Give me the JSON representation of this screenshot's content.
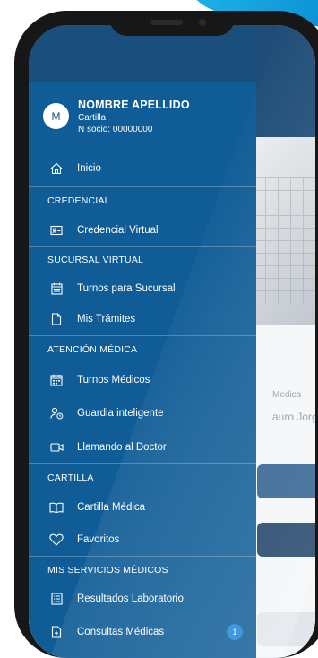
{
  "profile": {
    "initial": "M",
    "name": "NOMBRE APELLIDO",
    "plan": "Cartilla",
    "member_number": "N socio: 00000000"
  },
  "menu": {
    "inicio": "Inicio",
    "sec_credencial": "CREDENCIAL",
    "credencial_virtual": "Credencial Virtual",
    "sec_sucursal": "SUCURSAL VIRTUAL",
    "turnos_sucursal": "Turnos para Sucursal",
    "mis_tramites": "Mis Trámites",
    "sec_atencion": "ATENCIÓN MÉDICA",
    "turnos_medicos": "Turnos Médicos",
    "guardia": "Guardia inteligente",
    "llamando": "Llamando al Doctor",
    "sec_cartilla": "CARTILLA",
    "cartilla_medica": "Cartilla Médica",
    "favoritos": "Favoritos",
    "sec_servicios": "MIS SERVICIOS MÉDICOS",
    "resultados": "Resultados Laboratorio",
    "consultas": "Consultas Médicas",
    "consultas_badge": "1"
  },
  "background": {
    "label": "Medica",
    "doctor_name": "auro Jorge"
  },
  "colors": {
    "drawer": "#0f5c96",
    "header": "#1a4e7d",
    "accent": "#1fb6ea"
  }
}
